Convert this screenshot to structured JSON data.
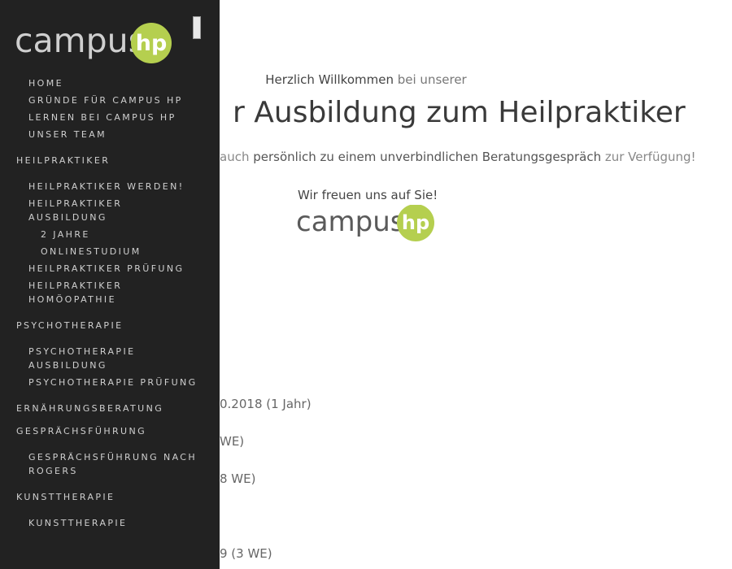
{
  "brand": {
    "name": "campus",
    "badge": "hp",
    "text_color": "#cfcfcf",
    "text_color_main": "#5a5a5a",
    "badge_color": "#b5cf4f"
  },
  "colors": {
    "drawer_bg": "#222222",
    "nav_text": "#cfcfcf",
    "page_bg": "#ffffff"
  },
  "nav": {
    "home": "Home",
    "gruende": "Gründe für Campus HP",
    "lernen": "Lernen bei Campus HP",
    "team": "Unser Team",
    "heilpraktiker": "Heilpraktiker",
    "hp_werden": "Heilpraktiker werden!",
    "hp_ausbildung": "Heilpraktiker Ausbildung",
    "zwei_jahre": "2 Jahre",
    "onlinestudium": "Onlinestudium",
    "hp_pruefung": "Heilpraktiker Prüfung",
    "hp_homoeopathie": "Heilpraktiker Homöopathie",
    "psychotherapie": "Psychotherapie",
    "psy_ausbildung": "Psychotherapie Ausbildung",
    "psy_pruefung": "Psychotherapie Prüfung",
    "ernaehrung": "Ernährungsberatung",
    "gespraech": "Gesprächsführung",
    "gespraech_rogers": "Gesprächsführung nach Rogers",
    "kunst": "Kunsttherapie",
    "kunst_sub": "Kunsttherapie"
  },
  "main": {
    "welcome_strong": "Herzlich Willkommen",
    "welcome_soft": "bei unserer",
    "headline": "r Ausbildung zum Heilpraktiker",
    "advice_soft_1": "auch",
    "advice_strong": "persönlich zu einem unverbindlichen Beratungsgespräch",
    "advice_soft_2": "zur Verfügung!",
    "freuen": "Wir freuen uns auf Sie!",
    "dates": [
      "0.2018 (1 Jahr)",
      "WE)",
      "8 WE)",
      "9 (3 WE)"
    ]
  }
}
